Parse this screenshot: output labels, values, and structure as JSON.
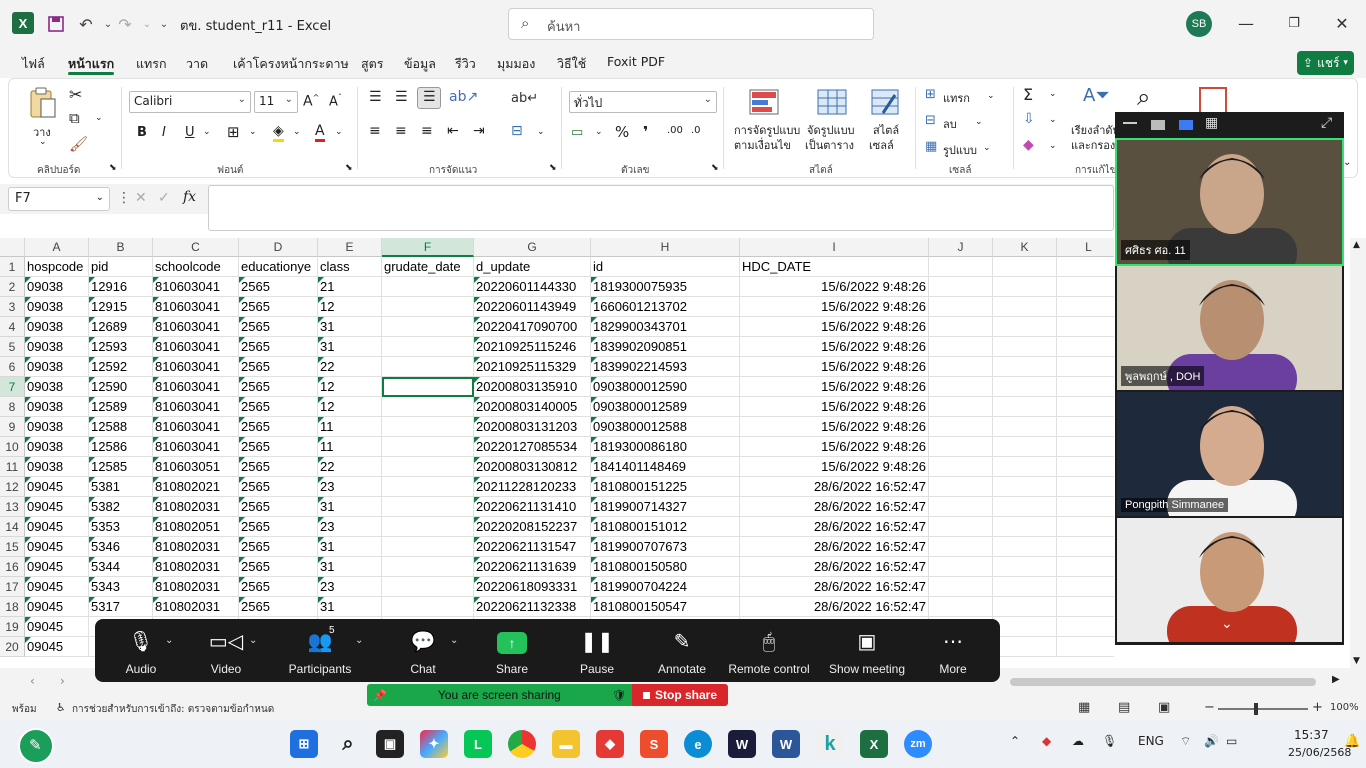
{
  "window": {
    "app": "X",
    "title": "ตข. student_r11  -  Excel",
    "search_placeholder": "ค้นหา",
    "user_initials": "SB",
    "share_label": "แชร์"
  },
  "menu": {
    "tabs": [
      "ไฟล์",
      "หน้าแรก",
      "แทรก",
      "วาด",
      "เค้าโครงหน้ากระดาษ",
      "สูตร",
      "ข้อมูล",
      "รีวิว",
      "มุมมอง",
      "วิธีใช้",
      "Foxit PDF"
    ],
    "active": "หน้าแรก"
  },
  "ribbon": {
    "paste_label": "วาง",
    "clipboard_group": "คลิปบอร์ด",
    "font_name": "Calibri",
    "font_size": "11",
    "font_group": "ฟอนต์",
    "alignment_group": "การจัดแนว",
    "number_format": "ทั่วไป",
    "number_group": "ตัวเลข",
    "conditional_label": "การจัดรูปแบบ",
    "conditional_label2": "ตามเงื่อนไข",
    "format_table_label": "จัดรูปแบบ",
    "format_table_label2": "เป็นตาราง",
    "cell_styles_label": "สไตล์",
    "cell_styles_label2": "เซลล์",
    "styles_group": "สไตล์",
    "insert_label": "แทรก",
    "delete_label": "ลบ",
    "format_label": "รูปแบบ",
    "cells_group": "เซลล์",
    "sort_label": "เรียงลำดับ",
    "sort_label2": "และกรอง",
    "editing_group": "การแก้ไข"
  },
  "formula_bar": {
    "name_box": "F7",
    "fx": "fx",
    "value": ""
  },
  "sheet": {
    "columns": [
      "A",
      "B",
      "C",
      "D",
      "E",
      "F",
      "G",
      "H",
      "I",
      "J",
      "K",
      "L"
    ],
    "selected_column": "F",
    "selected_row": 7,
    "rows": [
      [
        "hospcode",
        "pid",
        "schoolcode",
        "educationye",
        "class",
        "grudate_date",
        "d_update",
        "id",
        "HDC_DATE"
      ],
      [
        "09038",
        "12916",
        "810603041",
        "2565",
        "21",
        "",
        "20220601144330",
        "1819300075935",
        "15/6/2022 9:48:26"
      ],
      [
        "09038",
        "12915",
        "810603041",
        "2565",
        "12",
        "",
        "20220601143949",
        "1660601213702",
        "15/6/2022 9:48:26"
      ],
      [
        "09038",
        "12689",
        "810603041",
        "2565",
        "31",
        "",
        "20220417090700",
        "1829900343701",
        "15/6/2022 9:48:26"
      ],
      [
        "09038",
        "12593",
        "810603041",
        "2565",
        "31",
        "",
        "20210925115246",
        "1839902090851",
        "15/6/2022 9:48:26"
      ],
      [
        "09038",
        "12592",
        "810603041",
        "2565",
        "22",
        "",
        "20210925115329",
        "1839902214593",
        "15/6/2022 9:48:26"
      ],
      [
        "09038",
        "12590",
        "810603041",
        "2565",
        "12",
        "",
        "20200803135910",
        "0903800012590",
        "15/6/2022 9:48:26"
      ],
      [
        "09038",
        "12589",
        "810603041",
        "2565",
        "12",
        "",
        "20200803140005",
        "0903800012589",
        "15/6/2022 9:48:26"
      ],
      [
        "09038",
        "12588",
        "810603041",
        "2565",
        "11",
        "",
        "20200803131203",
        "0903800012588",
        "15/6/2022 9:48:26"
      ],
      [
        "09038",
        "12586",
        "810603041",
        "2565",
        "11",
        "",
        "20220127085534",
        "1819300086180",
        "15/6/2022 9:48:26"
      ],
      [
        "09038",
        "12585",
        "810603051",
        "2565",
        "22",
        "",
        "20200803130812",
        "1841401148469",
        "15/6/2022 9:48:26"
      ],
      [
        "09045",
        "5381",
        "810802021",
        "2565",
        "23",
        "",
        "20211228120233",
        "1810800151225",
        "28/6/2022 16:52:47"
      ],
      [
        "09045",
        "5382",
        "810802031",
        "2565",
        "31",
        "",
        "20220621131410",
        "1819900714327",
        "28/6/2022 16:52:47"
      ],
      [
        "09045",
        "5353",
        "810802051",
        "2565",
        "23",
        "",
        "20220208152237",
        "1810800151012",
        "28/6/2022 16:52:47"
      ],
      [
        "09045",
        "5346",
        "810802031",
        "2565",
        "31",
        "",
        "20220621131547",
        "1819900707673",
        "28/6/2022 16:52:47"
      ],
      [
        "09045",
        "5344",
        "810802031",
        "2565",
        "31",
        "",
        "20220621131639",
        "1810800150580",
        "28/6/2022 16:52:47"
      ],
      [
        "09045",
        "5343",
        "810802031",
        "2565",
        "23",
        "",
        "20220618093331",
        "1819900704224",
        "28/6/2022 16:52:47"
      ],
      [
        "09045",
        "5317",
        "810802031",
        "2565",
        "31",
        "",
        "20220621132338",
        "1810800150547",
        "28/6/2022 16:52:47"
      ],
      [
        "09045",
        "",
        "",
        "",
        "",
        "",
        "",
        "",
        ""
      ],
      [
        "09045",
        "",
        "",
        "",
        "",
        "",
        "",
        "",
        ""
      ]
    ]
  },
  "status": {
    "ready": "พร้อม",
    "accessibility": "การช่วยสำหรับการเข้าถึง: ตรวจตามข้อกำหนด",
    "zoom": "100%"
  },
  "zoom_toolbar": {
    "items": [
      {
        "label": "Audio",
        "icon": "microphone-icon"
      },
      {
        "label": "Video",
        "icon": "camera-icon"
      },
      {
        "label": "Participants",
        "icon": "participants-icon",
        "badge": "5"
      },
      {
        "label": "Chat",
        "icon": "chat-icon"
      },
      {
        "label": "Share",
        "icon": "share-screen-icon"
      },
      {
        "label": "Pause",
        "icon": "pause-icon"
      },
      {
        "label": "Annotate",
        "icon": "pen-icon"
      },
      {
        "label": "Remote control",
        "icon": "mouse-icon"
      },
      {
        "label": "Show meeting",
        "icon": "meeting-window-icon"
      },
      {
        "label": "More",
        "icon": "more-icon"
      }
    ],
    "sharing_text": "You are screen sharing",
    "stop_share": "Stop share"
  },
  "video_panel": {
    "participants": [
      {
        "name": "ศศิธร ศอ. 11",
        "skin": "#c9a58a",
        "bg": "#5a5040",
        "shirt": "#3a3a3a",
        "active": true
      },
      {
        "name": "พูลพฤกษ์ , DOH",
        "skin": "#b98f72",
        "bg": "#d8d2c4",
        "shirt": "#6a3fa0",
        "active": false
      },
      {
        "name": "Pongpith Simmanee",
        "skin": "#d4ab8e",
        "bg": "#1e2a3c",
        "shirt": "#f4f4f4",
        "active": false
      },
      {
        "name": "",
        "skin": "#c99a78",
        "bg": "#ececec",
        "shirt": "#c0321f",
        "active": false
      }
    ]
  },
  "taskbar": {
    "lang": "ENG",
    "time": "15:37",
    "date": "25/06/2568"
  }
}
